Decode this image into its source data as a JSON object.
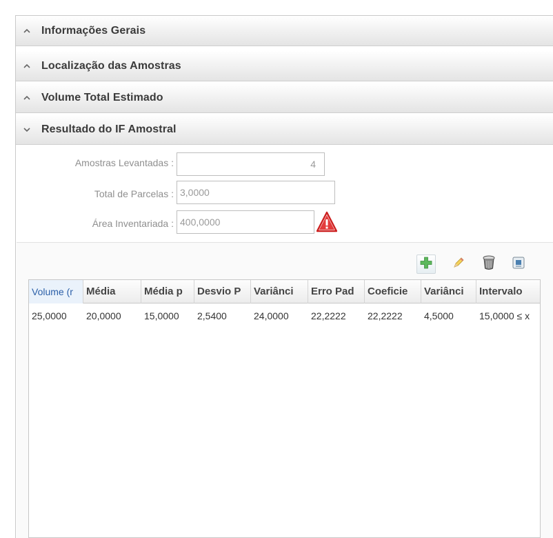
{
  "accordion": [
    {
      "label": "Informações Gerais",
      "expanded": false
    },
    {
      "label": "Localização das Amostras",
      "expanded": false
    },
    {
      "label": "Volume Total Estimado",
      "expanded": false
    },
    {
      "label": "Resultado do IF Amostral",
      "expanded": true
    }
  ],
  "form": {
    "amostras": {
      "label": "Amostras Levantadas :",
      "value": "4"
    },
    "parcelas": {
      "label": "Total de Parcelas  :",
      "value": "3,0000"
    },
    "area": {
      "label": "Área Inventariada :",
      "value": "400,0000"
    }
  },
  "toolbar": {
    "icons": [
      "add-icon",
      "edit-icon",
      "delete-icon",
      "export-icon"
    ]
  },
  "grid": {
    "columns": [
      "Volume (r",
      "Média",
      "Média p",
      "Desvio P",
      "Variânci",
      "Erro Pad",
      "Coeficie",
      "Variânci",
      "Intervalo"
    ],
    "rows": [
      [
        "25,0000",
        "20,0000",
        "15,0000",
        "2,5400",
        "24,0000",
        "22,2222",
        "22,2222",
        "4,5000",
        "15,0000 ≤ x"
      ]
    ]
  },
  "colors": {
    "warning": "#cc1f1f",
    "header_selected": "#2b5fa8",
    "add_green": "#5cb85c"
  }
}
